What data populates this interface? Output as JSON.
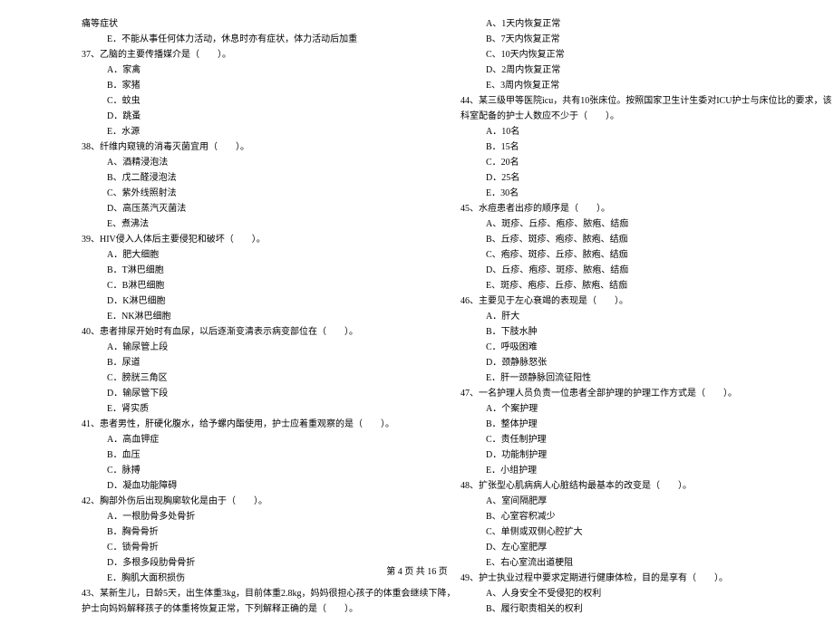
{
  "footer": "第 4 页  共 16 页",
  "left": [
    {
      "cls": "",
      "text": "痛等症状"
    },
    {
      "cls": "indent",
      "text": "E．不能从事任何体力活动，休息时亦有症状，体力活动后加重"
    },
    {
      "cls": "",
      "text": "37、乙脑的主要传播媒介是（　　）。"
    },
    {
      "cls": "indent",
      "text": "A．家禽"
    },
    {
      "cls": "indent",
      "text": "B．家猪"
    },
    {
      "cls": "indent",
      "text": "C．蚊虫"
    },
    {
      "cls": "indent",
      "text": "D．跳蚤"
    },
    {
      "cls": "indent",
      "text": "E．水源"
    },
    {
      "cls": "",
      "text": "38、纤维内窥镜的消毒灭菌宜用（　　）。"
    },
    {
      "cls": "indent",
      "text": "A、酒精浸泡法"
    },
    {
      "cls": "indent",
      "text": "B、戊二醛浸泡法"
    },
    {
      "cls": "indent",
      "text": "C、紫外线照射法"
    },
    {
      "cls": "indent",
      "text": "D、高压蒸汽灭菌法"
    },
    {
      "cls": "indent",
      "text": "E、煮沸法"
    },
    {
      "cls": "",
      "text": "39、HIV侵入人体后主要侵犯和破坏（　　）。"
    },
    {
      "cls": "indent",
      "text": "A．肥大细胞"
    },
    {
      "cls": "indent",
      "text": "B．T淋巴细胞"
    },
    {
      "cls": "indent",
      "text": "C．B淋巴细胞"
    },
    {
      "cls": "indent",
      "text": "D．K淋巴细胞"
    },
    {
      "cls": "indent",
      "text": "E．NK淋巴细胞"
    },
    {
      "cls": "",
      "text": "40、患者排尿开始时有血尿，以后逐渐变清表示病变部位在（　　）。"
    },
    {
      "cls": "indent",
      "text": "A．输尿管上段"
    },
    {
      "cls": "indent",
      "text": "B．尿道"
    },
    {
      "cls": "indent",
      "text": "C．膀胱三角区"
    },
    {
      "cls": "indent",
      "text": "D．输尿管下段"
    },
    {
      "cls": "indent",
      "text": "E．肾实质"
    },
    {
      "cls": "",
      "text": "41、患者男性，肝硬化腹水，给予螺内酯使用，护士应着重观察的是（　　）。"
    },
    {
      "cls": "indent",
      "text": "A．高血钾症"
    },
    {
      "cls": "indent",
      "text": "B．血压"
    },
    {
      "cls": "indent",
      "text": "C．脉搏"
    },
    {
      "cls": "indent",
      "text": "D．凝血功能障碍"
    },
    {
      "cls": "",
      "text": "42、胸部外伤后出现胸廓软化是由于（　　）。"
    },
    {
      "cls": "indent",
      "text": "A．一根肋骨多处骨折"
    },
    {
      "cls": "indent",
      "text": "B．胸骨骨折"
    },
    {
      "cls": "indent",
      "text": "C．锁骨骨折"
    },
    {
      "cls": "indent",
      "text": "D．多根多段肋骨骨折"
    },
    {
      "cls": "indent",
      "text": "E．胸肌大面积损伤"
    },
    {
      "cls": "",
      "text": "43、某新生儿，日龄5天，出生体重3kg，目前体重2.8kg，妈妈很担心孩子的体重会继续下降，"
    },
    {
      "cls": "",
      "text": "护士向妈妈解释孩子的体重将恢复正常，下列解释正确的是（　　）。"
    }
  ],
  "right": [
    {
      "cls": "indent",
      "text": "A、1天内恢复正常"
    },
    {
      "cls": "indent",
      "text": "B、7天内恢复正常"
    },
    {
      "cls": "indent",
      "text": "C、10天内恢复正常"
    },
    {
      "cls": "indent",
      "text": "D、2周内恢复正常"
    },
    {
      "cls": "indent",
      "text": "E、3周内恢复正常"
    },
    {
      "cls": "",
      "text": "44、某三级甲等医院icu，共有10张床位。按照国家卫生计生委对ICU护士与床位比的要求，该"
    },
    {
      "cls": "",
      "text": "科室配备的护士人数应不少于（　　）。"
    },
    {
      "cls": "indent",
      "text": "A．10名"
    },
    {
      "cls": "indent",
      "text": "B．15名"
    },
    {
      "cls": "indent",
      "text": "C．20名"
    },
    {
      "cls": "indent",
      "text": "D．25名"
    },
    {
      "cls": "indent",
      "text": "E．30名"
    },
    {
      "cls": "",
      "text": "45、水痘患者出疹的顺序是（　　）。"
    },
    {
      "cls": "indent",
      "text": "A、斑疹、丘疹、疱疹、脓疱、结痂"
    },
    {
      "cls": "indent",
      "text": "B、丘疹、斑疹、疱疹、脓疱、结痂"
    },
    {
      "cls": "indent",
      "text": "C、疱疹、斑疹、丘疹、脓疱、结痂"
    },
    {
      "cls": "indent",
      "text": "D、丘疹、疱疹、斑疹、脓疱、结痂"
    },
    {
      "cls": "indent",
      "text": "E、斑疹、疱疹、丘疹、脓疱、结痂"
    },
    {
      "cls": "",
      "text": "46、主要见于左心衰竭的表现是（　　）。"
    },
    {
      "cls": "indent",
      "text": "A．肝大"
    },
    {
      "cls": "indent",
      "text": "B．下肢水肿"
    },
    {
      "cls": "indent",
      "text": "C．呼吸困难"
    },
    {
      "cls": "indent",
      "text": "D．颈静脉怒张"
    },
    {
      "cls": "indent",
      "text": "E．肝一颈静脉回流征阳性"
    },
    {
      "cls": "",
      "text": "47、一名护理人员负责一位患者全部护理的护理工作方式是（　　）。"
    },
    {
      "cls": "indent",
      "text": "A．个案护理"
    },
    {
      "cls": "indent",
      "text": "B．整体护理"
    },
    {
      "cls": "indent",
      "text": "C．责任制护理"
    },
    {
      "cls": "indent",
      "text": "D．功能制护理"
    },
    {
      "cls": "indent",
      "text": "E．小组护理"
    },
    {
      "cls": "",
      "text": "48、扩张型心肌病病人心脏结构最基本的改变是（　　）。"
    },
    {
      "cls": "indent",
      "text": "A、室间隔肥厚"
    },
    {
      "cls": "indent",
      "text": "B、心室容积减少"
    },
    {
      "cls": "indent",
      "text": "C、单侧或双侧心腔扩大"
    },
    {
      "cls": "indent",
      "text": "D、左心室肥厚"
    },
    {
      "cls": "indent",
      "text": "E、右心室流出道梗阻"
    },
    {
      "cls": "",
      "text": "49、护士执业过程中要求定期进行健康体检，目的是享有（　　）。"
    },
    {
      "cls": "indent",
      "text": "A、人身安全不受侵犯的权利"
    },
    {
      "cls": "indent",
      "text": "B、履行职责相关的权利"
    }
  ]
}
